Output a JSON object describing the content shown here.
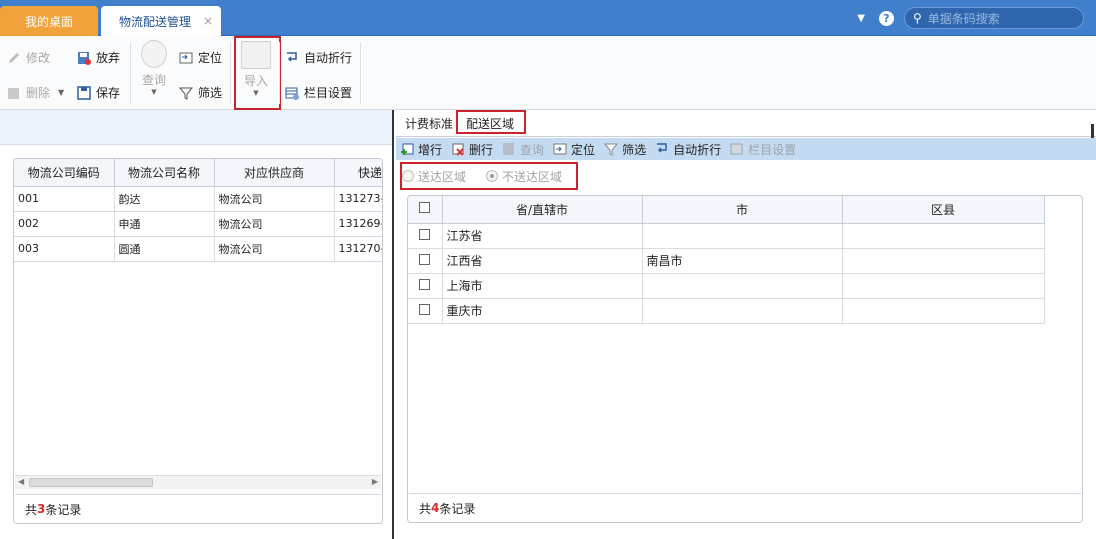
{
  "tabs": {
    "home": "我的桌面",
    "active": "物流配送管理",
    "close": "×"
  },
  "search": {
    "placeholder": "单据条码搜索"
  },
  "toolbar": {
    "edit": "修改",
    "abandon": "放弃",
    "delete": "删除",
    "save": "保存",
    "query": "查询",
    "locate": "定位",
    "filter": "筛选",
    "import": "导入",
    "autowrap": "自动折行",
    "columns": "栏目设置"
  },
  "left_grid": {
    "headers": [
      "物流公司编码",
      "物流公司名称",
      "对应供应商",
      "快递"
    ],
    "rows": [
      [
        "001",
        "韵达",
        "物流公司",
        "131273-"
      ],
      [
        "002",
        "申通",
        "物流公司",
        "131269-"
      ],
      [
        "003",
        "圆通",
        "物流公司",
        "131270-"
      ]
    ],
    "footer_prefix": "共",
    "count": "3",
    "footer_suffix": "条记录"
  },
  "right_tabs": {
    "billing": "计费标准",
    "area": "配送区域"
  },
  "right_toolbar": {
    "add_row": "增行",
    "del_row": "删行",
    "query": "查询",
    "locate": "定位",
    "filter": "筛选",
    "autowrap": "自动折行",
    "columns": "栏目设置"
  },
  "radios": {
    "deliver": "送达区域",
    "not_deliver": "不送达区域",
    "selected": "不送达区域"
  },
  "right_grid": {
    "headers": [
      "省/直辖市",
      "市",
      "区县"
    ],
    "rows": [
      [
        "江苏省",
        "",
        ""
      ],
      [
        "江西省",
        "南昌市",
        ""
      ],
      [
        "上海市",
        "",
        ""
      ],
      [
        "重庆市",
        "",
        ""
      ]
    ],
    "footer_prefix": "共",
    "count": "4",
    "footer_suffix": "条记录"
  },
  "colors": {
    "accent": "#3f7fcb",
    "home_tab": "#f2a23a",
    "highlight": "#c8242b",
    "count": "#d62b2b"
  }
}
